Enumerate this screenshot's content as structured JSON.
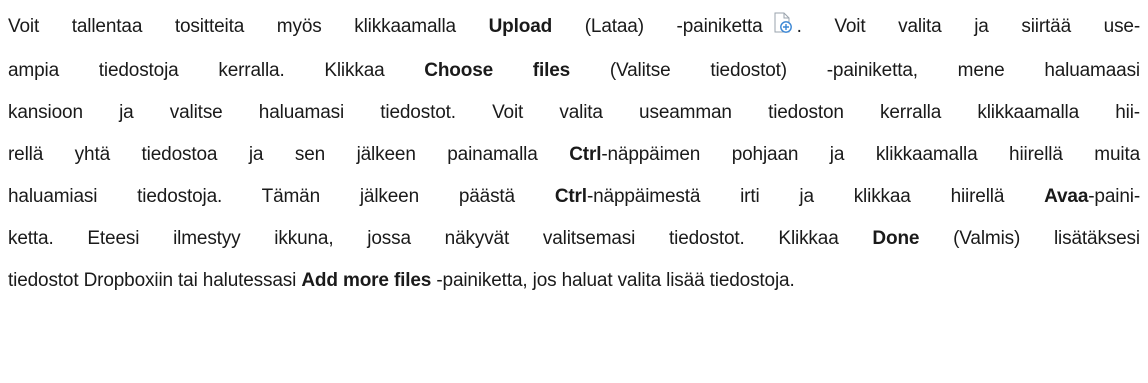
{
  "document": {
    "lines": [
      {
        "a": "Voit tallentaa tositteita myös klikkaamalla ",
        "b1": "Upload",
        "c": " (Lataa) -painiketta",
        "icon": "upload-file-icon",
        "d": ". Voit valita ja siirtää use-"
      },
      {
        "a": "ampia tiedostoja kerralla. Klikkaa ",
        "b1": "Choose files",
        "c": " (Valitse tiedostot) -painiketta, mene haluamaasi"
      },
      {
        "a": "kansioon ja valitse haluamasi tiedostot. Voit valita useamman tiedoston kerralla klikkaamalla hii-"
      },
      {
        "a": "rellä yhtä tiedostoa ja sen jälkeen painamalla ",
        "b1": "Ctrl",
        "c": "-näppäimen pohjaan ja klikkaamalla hiirellä muita"
      },
      {
        "a": "haluamiasi tiedostoja. Tämän jälkeen päästä ",
        "b1": "Ctrl",
        "c": "-näppäimestä irti ja klikkaa hiirellä ",
        "b2": "Avaa",
        "d": "-paini-"
      },
      {
        "a": "ketta. Eteesi ilmestyy ikkuna, jossa näkyvät valitsemasi tiedostot. Klikkaa ",
        "b1": "Done",
        "c": " (Valmis) lisätäksesi"
      },
      {
        "a": "tiedostot Dropboxiin tai halutessasi ",
        "b1": "Add more files",
        "c": " -painiketta, jos haluat valita lisää tiedostoja."
      }
    ]
  },
  "colors": {
    "text": "#1a1a1a",
    "icon_blue": "#3a86d4",
    "icon_outline": "#9aa3ad"
  }
}
